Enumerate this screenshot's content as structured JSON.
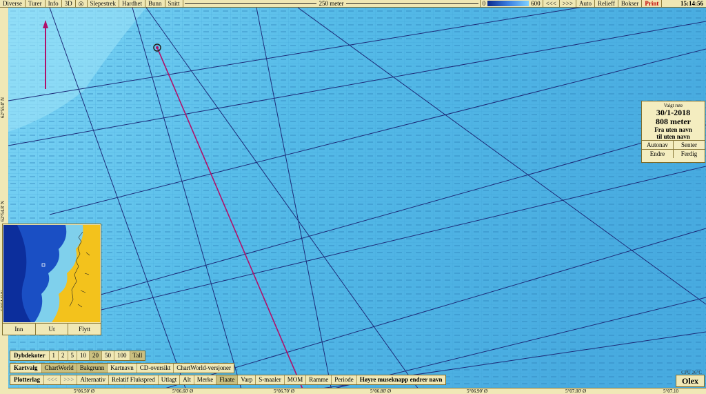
{
  "topbar": {
    "menus": [
      "Diverse",
      "Turer",
      "Info",
      "3D"
    ],
    "tools": [
      "Slepestrek",
      "Hardhet",
      "Bunn",
      "Snitt"
    ],
    "scale_label": "250 meter",
    "depth_min": "0",
    "depth_max": "600",
    "nav": [
      "<<<",
      ">>>",
      "Auto",
      "Relieff",
      "Bokser"
    ],
    "print_label": "Print",
    "clock": "15:14:56"
  },
  "latitudes": [
    "62°55.0' N",
    "62°54.8' N",
    "62°54.6' N"
  ],
  "longitudes": [
    "5°06.50' Ø",
    "5°06.60' Ø",
    "5°06.70' Ø",
    "5°06.80' Ø",
    "5°06.90' Ø",
    "5°07.00' Ø",
    "5°07.10"
  ],
  "route_info": {
    "header": "Valgt rute",
    "date": "30/1-2018",
    "distance": "808 meter",
    "from": "Fra uten navn",
    "to": "til uten navn",
    "btn_autonav": "Autonav",
    "btn_senter": "Senter",
    "btn_endre": "Endre",
    "btn_ferdig": "Ferdig"
  },
  "minimap": {
    "btn_inn": "Inn",
    "btn_ut": "Ut",
    "btn_flytt": "Flytt"
  },
  "dybdekoter": {
    "label": "Dybdekoter",
    "options": [
      "1",
      "2",
      "5",
      "10",
      "20",
      "50",
      "100",
      "Tall"
    ]
  },
  "kartvalg": {
    "label": "Kartvalg",
    "options": [
      "ChartWorld",
      "Bakgrunn",
      "Kartnavn",
      "CD-oversikt",
      "ChartWorld-versjoner"
    ]
  },
  "plotterlag": {
    "label": "Plotterlag",
    "nav": [
      "<<<",
      ">>>"
    ],
    "options": [
      "Alternativ",
      "Relatif Flukspred",
      "Utlagt",
      "Alt",
      "Merke",
      "Flaate",
      "Varp",
      "S-maaler",
      "MOM",
      "Ramme",
      "Periode"
    ],
    "hint": "Høyre museknapp endrer navn"
  },
  "cpu": "CPU 26°C",
  "brand": "Olex",
  "colors": {
    "accent": "#c00000",
    "panel": "#f0e8b6",
    "sea": "#56bce8",
    "route": "#b0106a"
  }
}
